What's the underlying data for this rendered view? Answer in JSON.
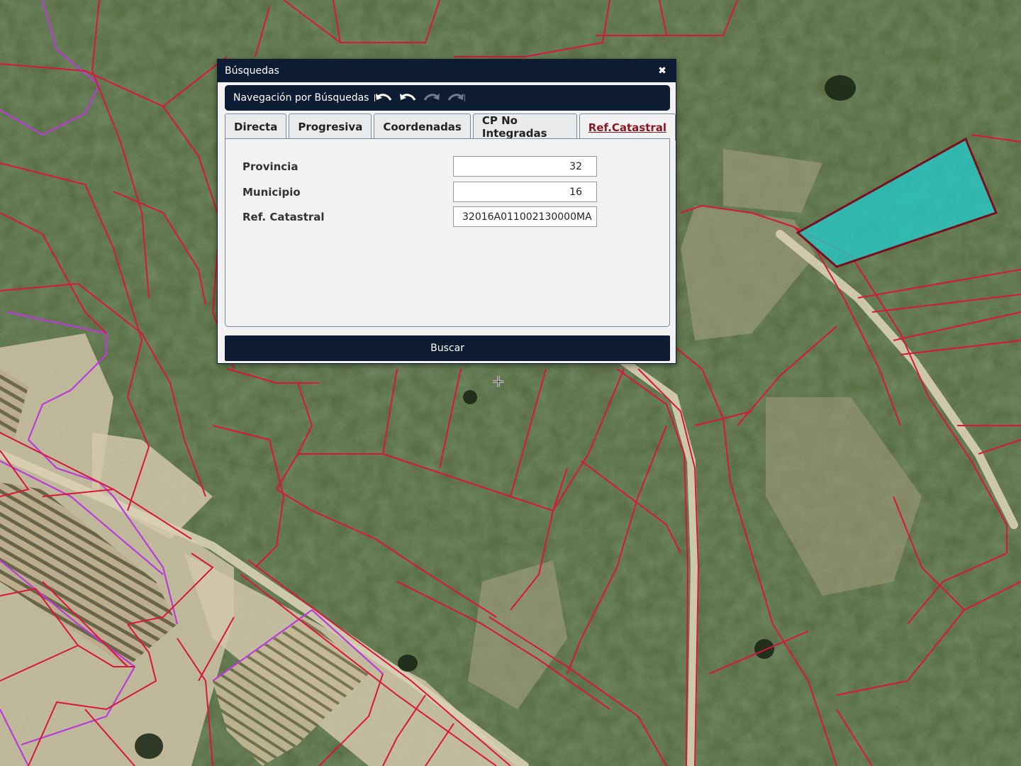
{
  "dialog": {
    "title": "Búsquedas",
    "close_glyph": "✖",
    "navigation_label": "Navegación por Búsquedas",
    "nav_icons": [
      "undo-all-icon",
      "undo-icon",
      "redo-icon",
      "redo-all-icon"
    ]
  },
  "tabs": [
    {
      "label": "Directa",
      "active": false
    },
    {
      "label": "Progresiva",
      "active": false
    },
    {
      "label": "Coordenadas",
      "active": false
    },
    {
      "label": "CP No Integradas",
      "active": false
    },
    {
      "label": "Ref.Catastral",
      "active": true
    }
  ],
  "form": {
    "provincia": {
      "label": "Provincia",
      "value": "32"
    },
    "municipio": {
      "label": "Municipio",
      "value": "16"
    },
    "ref_catastral": {
      "label": "Ref. Catastral",
      "value": "32016A011002130000MA"
    }
  },
  "search_button": "Buscar",
  "colors": {
    "header_bg": "#0d1b33",
    "active_tab_text": "#8a1822",
    "parcel_line": "#d8163c",
    "selected_parcel_fill": "#22c9c9",
    "selected_parcel_outline": "#7a0f1e",
    "zone_line": "#b93bd8"
  }
}
